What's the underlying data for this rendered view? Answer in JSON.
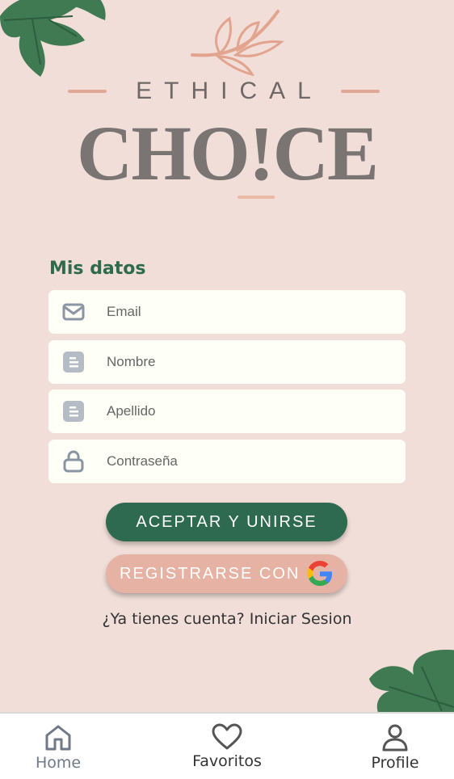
{
  "brand": {
    "top_word": "ETHICAL",
    "main_word": "CHO!CE"
  },
  "form": {
    "title": "Mis datos",
    "fields": [
      {
        "icon": "mail-icon",
        "placeholder": "Email"
      },
      {
        "icon": "document-icon",
        "placeholder": "Nombre"
      },
      {
        "icon": "document-icon",
        "placeholder": "Apellido"
      },
      {
        "icon": "lock-icon",
        "placeholder": "Contraseña"
      }
    ],
    "accept_label": "ACEPTAR Y UNIRSE",
    "google_label": "REGISTRARSE CON",
    "login_prompt": "¿Ya tienes cuenta?",
    "login_link": "Iniciar Sesion"
  },
  "nav": {
    "items": [
      {
        "label": "Home",
        "icon": "home-icon",
        "active": true
      },
      {
        "label": "Favoritos",
        "icon": "heart-icon",
        "active": false
      },
      {
        "label": "Profile",
        "icon": "user-icon",
        "active": false
      }
    ]
  },
  "colors": {
    "background": "#f1ded8",
    "primary_green": "#2d6a4f",
    "accent_pink": "#e6b2a4",
    "field_bg": "#fefff6",
    "logo_gray": "#7a7472"
  }
}
